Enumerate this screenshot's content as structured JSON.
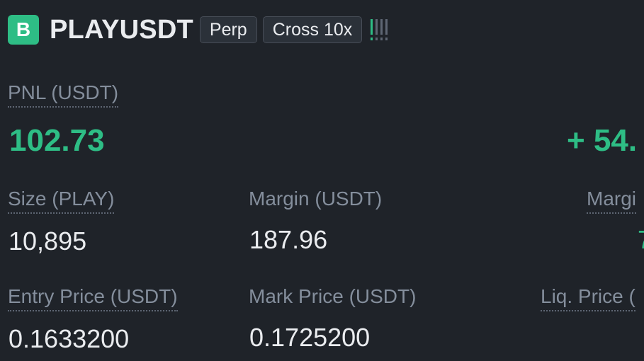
{
  "header": {
    "side_badge": "B",
    "symbol": "PLAYUSDT",
    "contract_type": "Perp",
    "margin_mode": "Cross 10x",
    "risk_indicator": {
      "active_bars": 1,
      "total_bars": 4,
      "icon": "risk-level-icon"
    }
  },
  "pnl": {
    "label": "PNL (USDT)",
    "value": "102.73"
  },
  "roe": {
    "value": "+ 54."
  },
  "size": {
    "label": "Size (PLAY)",
    "value": "10,895"
  },
  "margin": {
    "label": "Margin (USDT)",
    "value": "187.96"
  },
  "margin_ratio": {
    "label": "Margi",
    "value": "7"
  },
  "entry_price": {
    "label": "Entry Price (USDT)",
    "value": "0.1633200"
  },
  "mark_price": {
    "label": "Mark Price (USDT)",
    "value": "0.1725200"
  },
  "liq_price": {
    "label": "Liq. Price ("
  },
  "colors": {
    "background": "#1f2329",
    "positive": "#2ebd85",
    "label": "#848e9c",
    "text": "#eaecef"
  }
}
